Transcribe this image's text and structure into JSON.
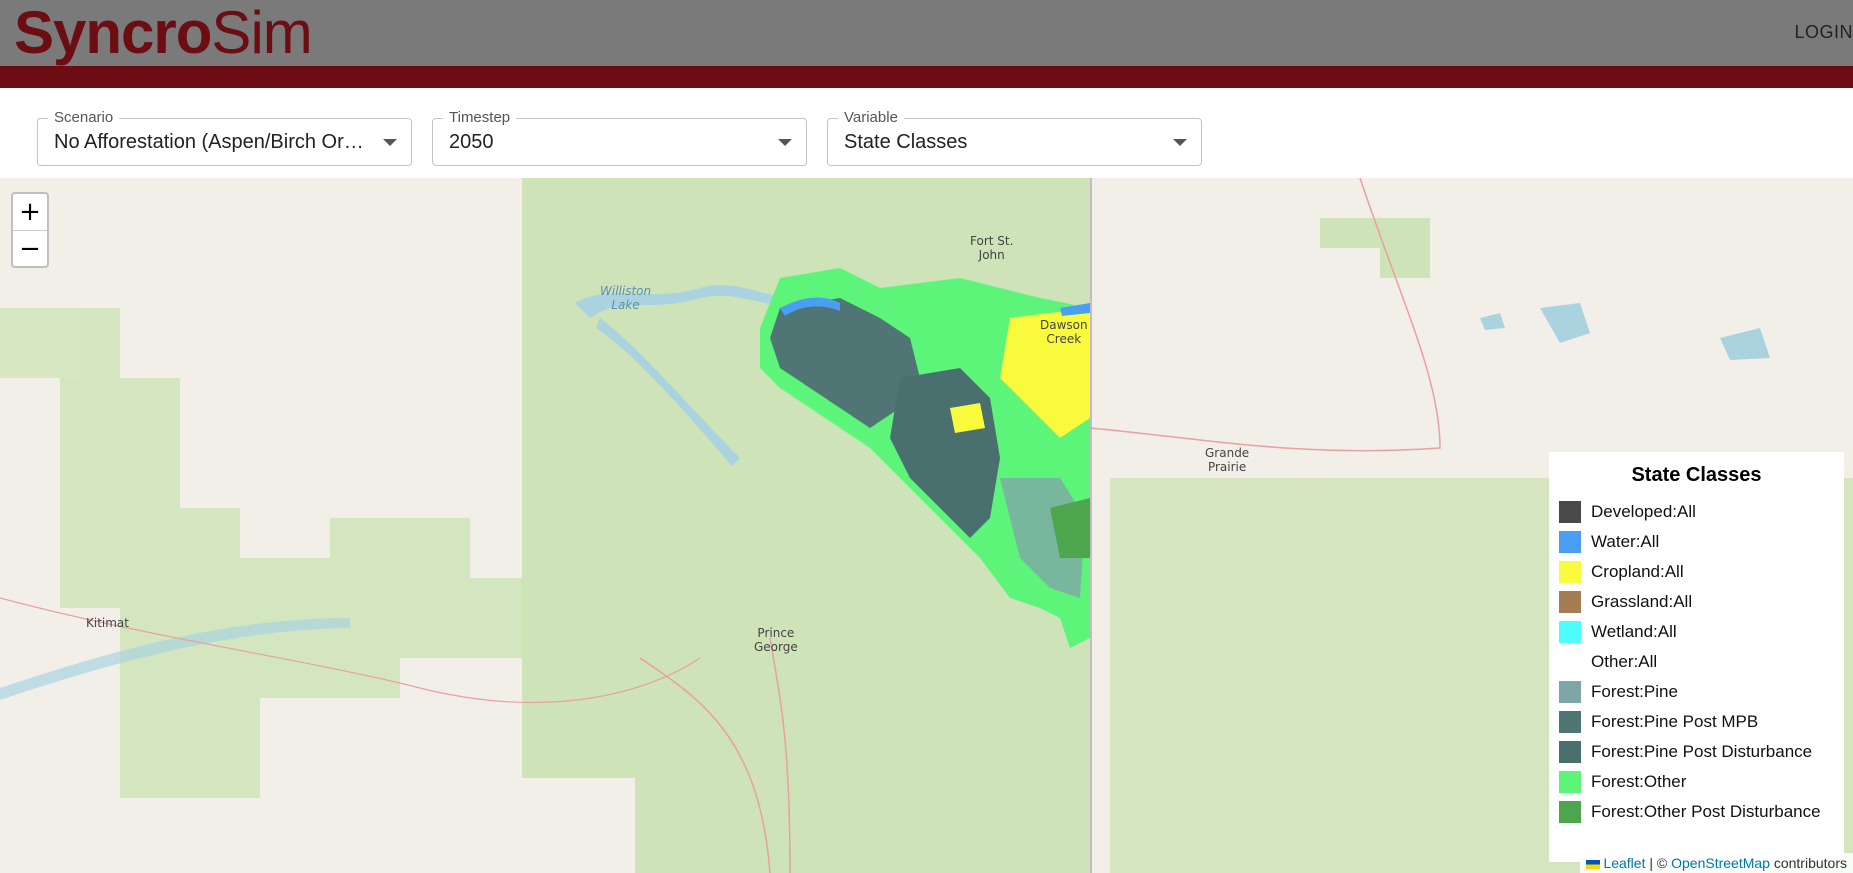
{
  "header": {
    "logo_bold": "Syncro",
    "logo_thin": "Sim",
    "login_label": "LOGIN"
  },
  "controls": {
    "scenario": {
      "label": "Scenario",
      "value": "No Afforestation (Aspen/Birch Or…"
    },
    "timestep": {
      "label": "Timestep",
      "value": "2050"
    },
    "variable": {
      "label": "Variable",
      "value": "State Classes"
    }
  },
  "map": {
    "zoom_in": "+",
    "zoom_out": "−",
    "places": {
      "fort_st_john": "Fort St.\nJohn",
      "williston_lake": "Williston\nLake",
      "dawson_creek": "Dawson\nCreek",
      "grande_prairie": "Grande\nPrairie",
      "kitimat": "Kitimat",
      "prince_george": "Prince\nGeorge"
    }
  },
  "legend": {
    "title": "State Classes",
    "items": [
      {
        "label": "Developed:All",
        "color": "#4a4a4a"
      },
      {
        "label": "Water:All",
        "color": "#4a9ff5"
      },
      {
        "label": "Cropland:All",
        "color": "#fafa3c"
      },
      {
        "label": "Grassland:All",
        "color": "#a67c52"
      },
      {
        "label": "Wetland:All",
        "color": "#4dfcfc"
      },
      {
        "label": "Other:All",
        "color": "#ffffff"
      },
      {
        "label": "Forest:Pine",
        "color": "#7fa6a6"
      },
      {
        "label": "Forest:Pine Post MPB",
        "color": "#4f7575"
      },
      {
        "label": "Forest:Pine Post Disturbance",
        "color": "#4a6f6f"
      },
      {
        "label": "Forest:Other",
        "color": "#5cf57a"
      },
      {
        "label": "Forest:Other Post Disturbance",
        "color": "#4da64d"
      }
    ]
  },
  "attribution": {
    "leaflet": "Leaflet",
    "separator": " | © ",
    "osm": "OpenStreetMap",
    "suffix": " contributors"
  }
}
